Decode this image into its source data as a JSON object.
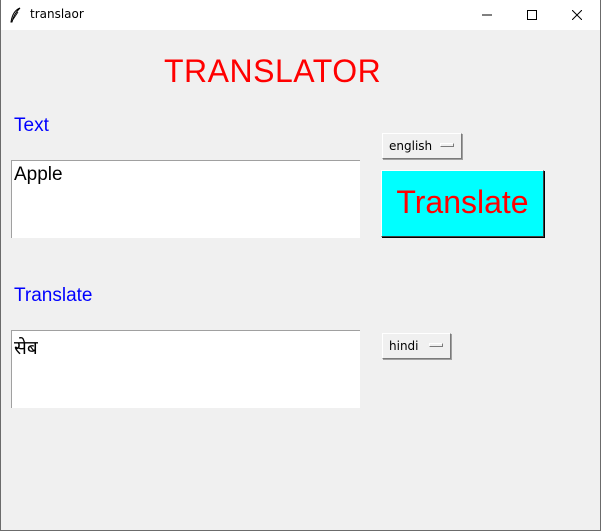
{
  "window": {
    "title": "translaor",
    "icon": "feather-icon",
    "controls": [
      "minimize-icon",
      "maximize-icon",
      "close-icon"
    ]
  },
  "heading": "TRANSLATOR",
  "source": {
    "label": "Text",
    "text": "Apple",
    "language": "english"
  },
  "action": {
    "button_label": "Translate"
  },
  "output": {
    "label": "Translate",
    "text": "सेब",
    "language": "hindi"
  },
  "colors": {
    "heading": "#ff0000",
    "labels": "#0000ff",
    "button_bg": "#00ffff",
    "button_text": "#ff0000",
    "window_bg": "#f0f0f0"
  }
}
